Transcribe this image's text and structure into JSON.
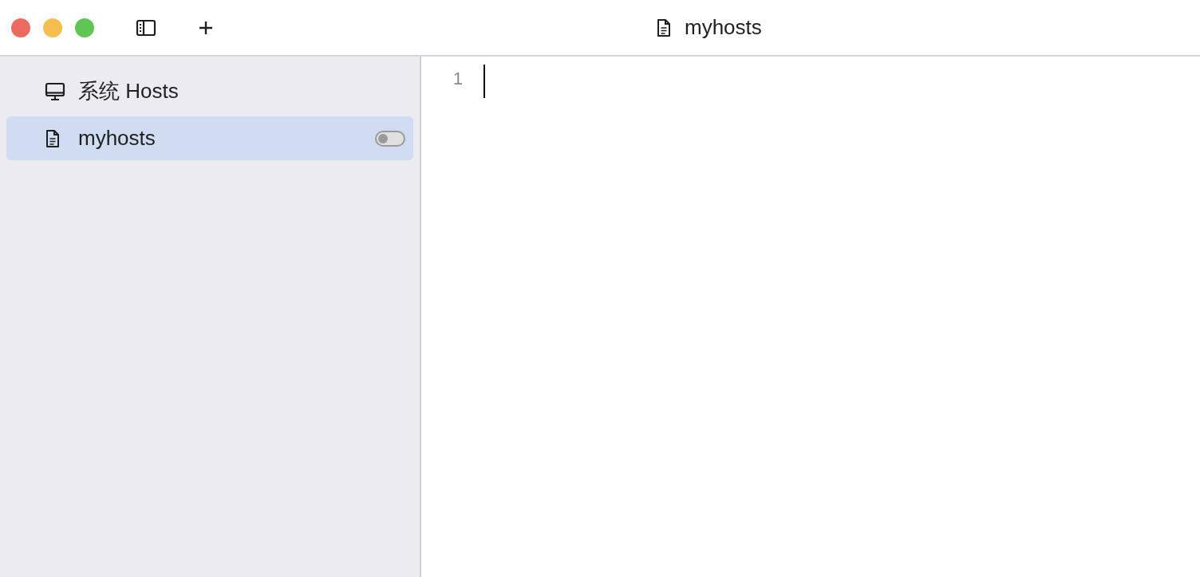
{
  "window": {
    "title": "myhosts"
  },
  "sidebar": {
    "items": [
      {
        "label": "系统 Hosts",
        "kind": "system",
        "selected": false
      },
      {
        "label": "myhosts",
        "kind": "file",
        "selected": true,
        "on": false
      }
    ]
  },
  "editor": {
    "line_numbers": [
      "1"
    ]
  }
}
